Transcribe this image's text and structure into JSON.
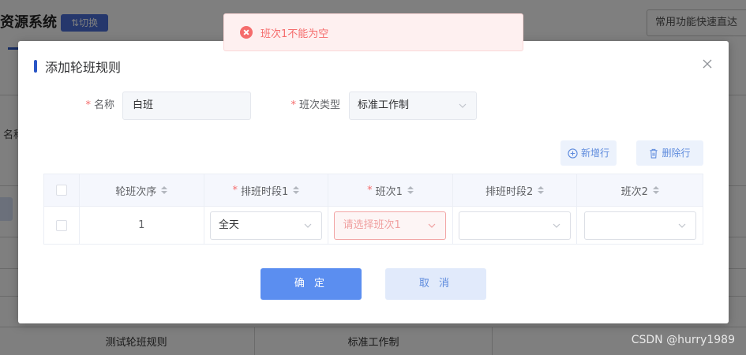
{
  "background": {
    "title": "资源系统",
    "switch_label": "⇅切换",
    "quick_label": "常用功能快速直达",
    "name_label": "名称",
    "row": [
      "测试轮班规则",
      "标准工作制",
      ""
    ]
  },
  "toast": {
    "message": "班次1不能为空",
    "type": "error"
  },
  "dialog": {
    "title": "添加轮班规则",
    "form": {
      "name_label": "名称",
      "name_value": "白班",
      "shift_type_label": "班次类型",
      "shift_type_value": "标准工作制"
    },
    "add_row_label": "新增行",
    "delete_row_label": "删除行",
    "table": {
      "headers": [
        {
          "label": "轮班次序",
          "required": false
        },
        {
          "label": "排班时段1",
          "required": true
        },
        {
          "label": "班次1",
          "required": true
        },
        {
          "label": "排班时段2",
          "required": false
        },
        {
          "label": "班次2",
          "required": false
        }
      ],
      "rows": [
        {
          "order": "1",
          "period1": "全天",
          "shift1_placeholder": "请选择班次1",
          "period2": "",
          "shift2": ""
        }
      ]
    },
    "confirm_label": "确 定",
    "cancel_label": "取 消"
  },
  "watermark": "CSDN @hurry1989",
  "colors": {
    "accent": "#5b8ef0",
    "error": "#f56c6c",
    "title_bar": "#2a56c6"
  }
}
